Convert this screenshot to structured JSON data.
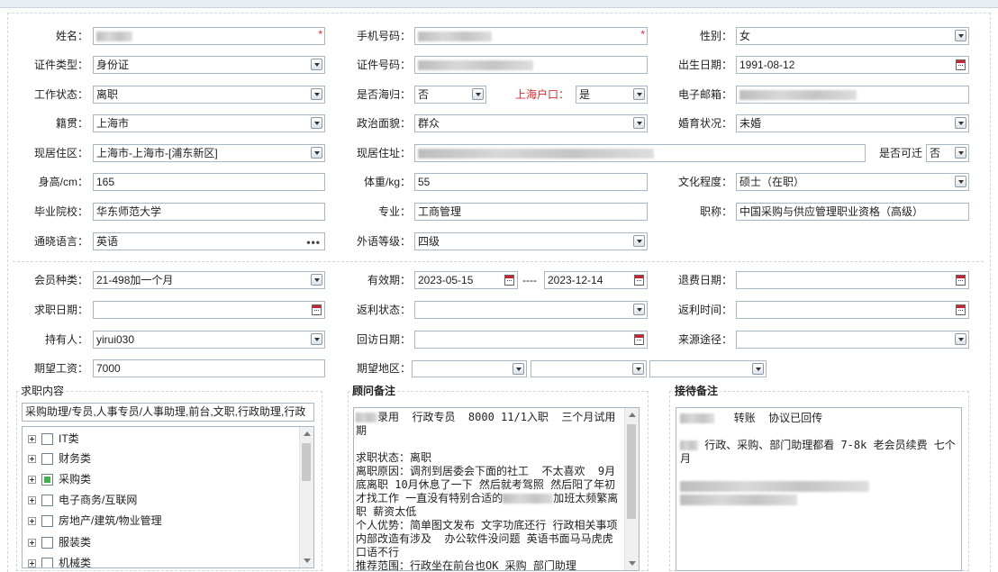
{
  "form": {
    "name": {
      "label": "姓名：",
      "required": "*"
    },
    "mobile": {
      "label": "手机号码：",
      "required": "*"
    },
    "gender": {
      "label": "性别：",
      "value": "女"
    },
    "id_type": {
      "label": "证件类型：",
      "value": "身份证"
    },
    "id_number": {
      "label": "证件号码："
    },
    "birth_date": {
      "label": "出生日期：",
      "value": "1991-08-12"
    },
    "work_status": {
      "label": "工作状态：",
      "value": "离职"
    },
    "returnee": {
      "label": "是否海归：",
      "value": "否"
    },
    "shanghai_hukou": {
      "label": "上海户口：",
      "value": "是"
    },
    "email": {
      "label": "电子邮箱："
    },
    "native_place": {
      "label": "籍贯：",
      "value": "上海市"
    },
    "political_status": {
      "label": "政治面貌：",
      "value": "群众"
    },
    "marital_status": {
      "label": "婚育状况：",
      "value": "未婚"
    },
    "residence_area": {
      "label": "现居住区：",
      "value": "上海市-上海市-[浦东新区]"
    },
    "address": {
      "label": "现居住址："
    },
    "relocate": {
      "label": "是否可迁",
      "value": "否"
    },
    "height": {
      "label": "身高/cm：",
      "value": "165"
    },
    "weight": {
      "label": "体重/kg：",
      "value": "55"
    },
    "education": {
      "label": "文化程度：",
      "value": "硕士（在职）"
    },
    "school": {
      "label": "毕业院校：",
      "value": "华东师范大学"
    },
    "major": {
      "label": "专业：",
      "value": "工商管理"
    },
    "title": {
      "label": "职称：",
      "value": "中国采购与供应管理职业资格（高级）"
    },
    "language": {
      "label": "通晓语言：",
      "value": "英语"
    },
    "language_level": {
      "label": "外语等级：",
      "value": "四级"
    }
  },
  "membership": {
    "member_type": {
      "label": "会员种类：",
      "value": "21-498加一个月"
    },
    "validity": {
      "label": "有效期：",
      "from": "2023-05-15",
      "separator": "----",
      "to": "2023-12-14"
    },
    "refund_date": {
      "label": "退费日期："
    },
    "job_seek_date": {
      "label": "求职日期："
    },
    "rebate_status": {
      "label": "返利状态："
    },
    "rebate_time": {
      "label": "返利时间："
    },
    "holder": {
      "label": "持有人：",
      "value": "yirui030"
    },
    "visit_date": {
      "label": "回访日期："
    },
    "source": {
      "label": "来源途径："
    },
    "expected_salary": {
      "label": "期望工资：",
      "value": "7000"
    },
    "expected_region": {
      "label": "期望地区："
    }
  },
  "job_panel": {
    "title": "求职内容",
    "summary": "采购助理/专员,人事专员/人事助理,前台,文职,行政助理,行政",
    "categories": [
      {
        "label": "IT类",
        "checked": false
      },
      {
        "label": "财务类",
        "checked": false
      },
      {
        "label": "采购类",
        "checked": true
      },
      {
        "label": "电子商务/互联网",
        "checked": false
      },
      {
        "label": "房地产/建筑/物业管理",
        "checked": false
      },
      {
        "label": "服装类",
        "checked": false
      },
      {
        "label": "机械类",
        "checked": false
      }
    ]
  },
  "advisor_panel": {
    "title": "顾问备注",
    "lines": [
      "录用  行政专员  8000 11/1入职  三个月试用期",
      "",
      "求职状态：离职",
      "离职原因：调剂到居委会下面的社工  不太喜欢  9月底离职 10月休息了一下 然后就考驾照 然后阳了年初才找工作 一直没有特别合适的",
      "加班太频繁离职",
      "薪资太低",
      "个人优势：简单图文发布 文字功底还行 行政相关事项 内部改造有涉及  办公软件没问题 英语书面马马虎虎 口语不行",
      "推荐范围：行政坐在前台也OK 采购 部门助理"
    ]
  },
  "reception_panel": {
    "title": "接待备注",
    "line1": "转账  协议已回传",
    "line2": "行政、采购、部门助理都看 7-8k 老会员续费 七个月"
  }
}
